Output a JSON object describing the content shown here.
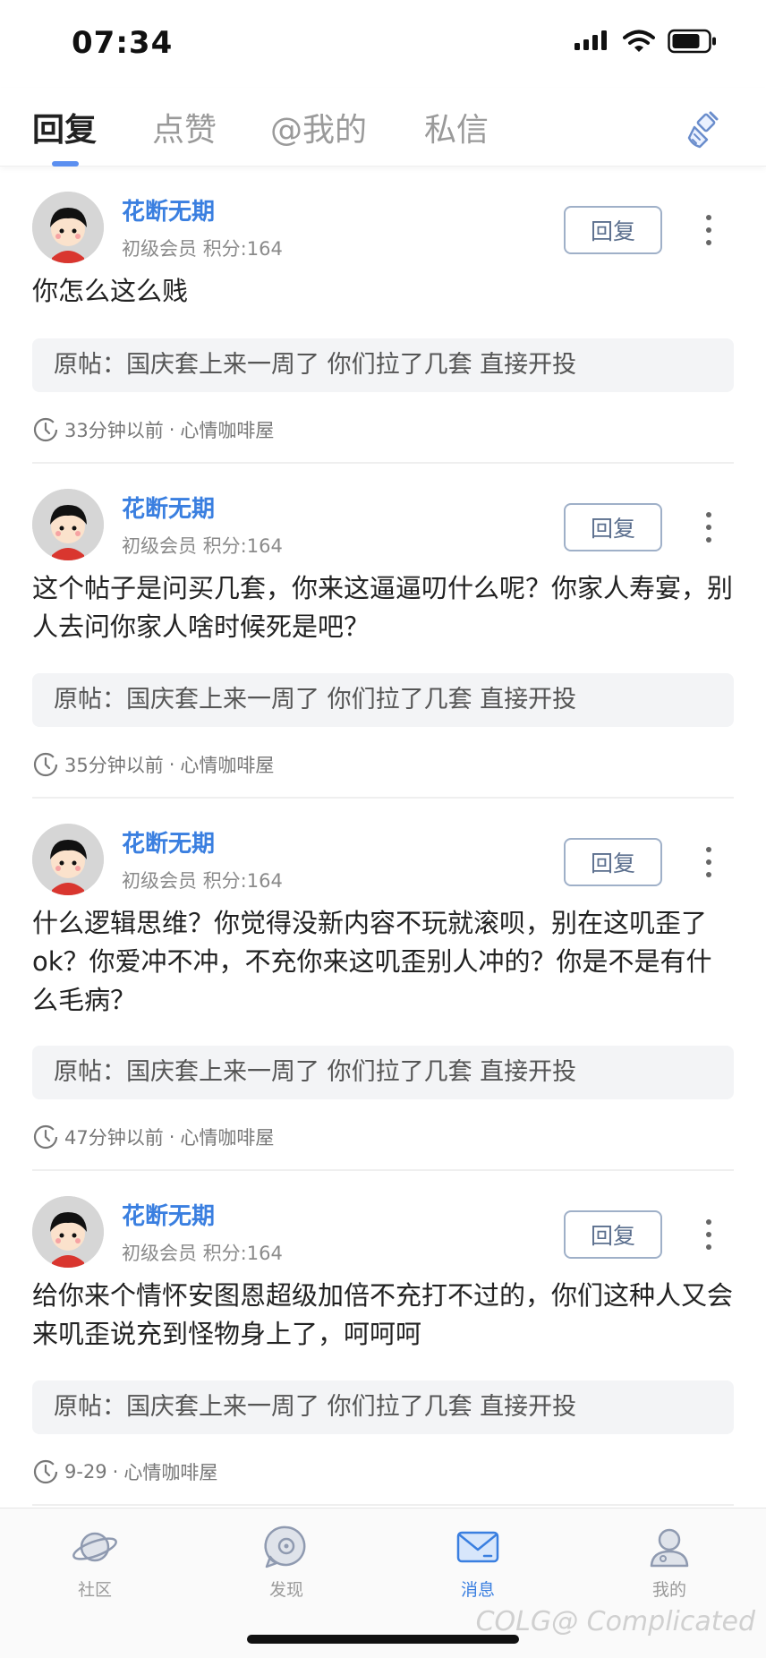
{
  "status_bar": {
    "time": "07:34"
  },
  "tabs": [
    {
      "label": "回复",
      "active": true
    },
    {
      "label": "点赞",
      "active": false
    },
    {
      "label": "@我的",
      "active": false
    },
    {
      "label": "私信",
      "active": false
    }
  ],
  "colors": {
    "accent": "#3a7fe0",
    "button_border": "#9fb0c8"
  },
  "messages": [
    {
      "user": "花断无期",
      "level": "初级会员",
      "points": "积分:164",
      "reply_label": "回复",
      "content": "你怎么这么贱",
      "original": "原帖：国庆套上来一周了 你们拉了几套  直接开投",
      "time": "33分钟以前",
      "separator": "·",
      "board": "心情咖啡屋"
    },
    {
      "user": "花断无期",
      "level": "初级会员",
      "points": "积分:164",
      "reply_label": "回复",
      "content": "这个帖子是问买几套，你来这逼逼叨什么呢？你家人寿宴，别人去问你家人啥时候死是吧？",
      "original": "原帖：国庆套上来一周了 你们拉了几套  直接开投",
      "time": "35分钟以前",
      "separator": "·",
      "board": "心情咖啡屋"
    },
    {
      "user": "花断无期",
      "level": "初级会员",
      "points": "积分:164",
      "reply_label": "回复",
      "content": "什么逻辑思维？你觉得没新内容不玩就滚呗，别在这叽歪了ok？你爱冲不冲，不充你来这叽歪别人冲的？你是不是有什么毛病？",
      "original": "原帖：国庆套上来一周了 你们拉了几套  直接开投",
      "time": "47分钟以前",
      "separator": "·",
      "board": "心情咖啡屋"
    },
    {
      "user": "花断无期",
      "level": "初级会员",
      "points": "积分:164",
      "reply_label": "回复",
      "content": "给你来个情怀安图恩超级加倍不充打不过的，你们这种人又会来叽歪说充到怪物身上了，呵呵呵",
      "original": "原帖：国庆套上来一周了 你们拉了几套  直接开投",
      "time": "9-29",
      "separator": "·",
      "board": "心情咖啡屋"
    }
  ],
  "bottom_nav": [
    {
      "label": "社区",
      "icon": "planet-icon",
      "active": false
    },
    {
      "label": "发现",
      "icon": "discover-icon",
      "active": false
    },
    {
      "label": "消息",
      "icon": "mail-icon",
      "active": true
    },
    {
      "label": "我的",
      "icon": "profile-icon",
      "active": false
    }
  ],
  "watermark": "COLG@ Complicated"
}
